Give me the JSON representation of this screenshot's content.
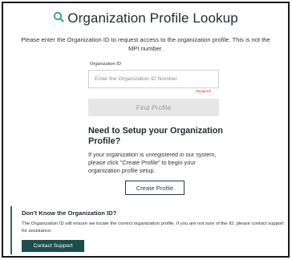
{
  "header": {
    "title": "Organization Profile Lookup",
    "icon": "search-icon",
    "accent_color": "#2a9d8f"
  },
  "intro": {
    "text": "Please enter the Organization ID to request access to the organization profile. This is not the MPI number."
  },
  "lookup": {
    "field_label": "Organization ID",
    "input_value": "",
    "input_placeholder": "Enter the Organization ID Number",
    "required_note": "Required",
    "find_button_label": "Find Profile",
    "find_button_enabled": false
  },
  "setup": {
    "heading": "Need to Setup your Organization Profile?",
    "body": "If your organization is unregistered in our system, please click \"Create Profile\" to begin your organization profile setup.",
    "create_button_label": "Create Profile"
  },
  "help": {
    "heading": "Don't Know the Organization ID?",
    "text": "The Organization ID will ensure we locate the correct organization profile. If you are not sure of the ID, please contact support for assistance.",
    "support_button_label": "Contact Support",
    "accent_color": "#1b4f49"
  }
}
